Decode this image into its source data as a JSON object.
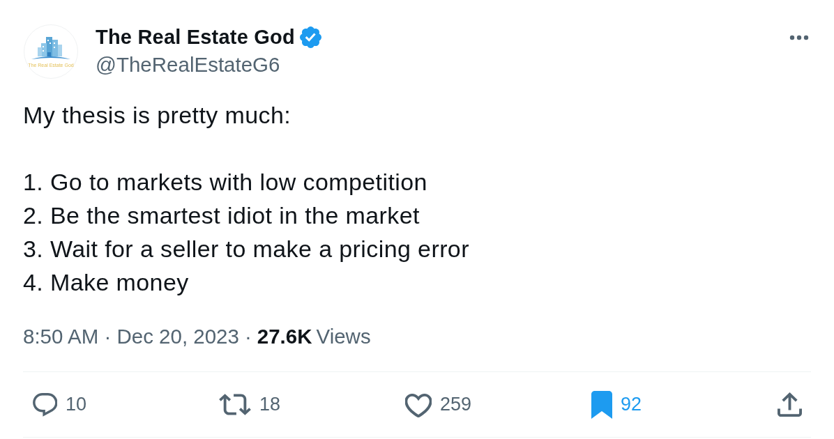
{
  "author": {
    "avatar": {
      "logo_text": "The Real Estate God"
    },
    "name": "The Real Estate God",
    "verified": true,
    "handle": "@TheRealEstateG6"
  },
  "tweet": {
    "text": "My thesis is pretty much:\n\n1. Go to markets with low competition\n2. Be the smartest idiot in the market\n3. Wait for a seller to make a pricing error\n4. Make money"
  },
  "meta": {
    "timestamp": "8:50 AM · Dec 20, 2023",
    "separator": "·",
    "views_count": "27.6K",
    "views_label": "Views"
  },
  "actions": [
    {
      "kind": "reply",
      "count": "10",
      "selected": false
    },
    {
      "kind": "retweet",
      "count": "18",
      "selected": false
    },
    {
      "kind": "like",
      "count": "259",
      "selected": false
    },
    {
      "kind": "bookmark",
      "count": "92",
      "selected": true
    },
    {
      "kind": "share",
      "selected": false
    }
  ]
}
